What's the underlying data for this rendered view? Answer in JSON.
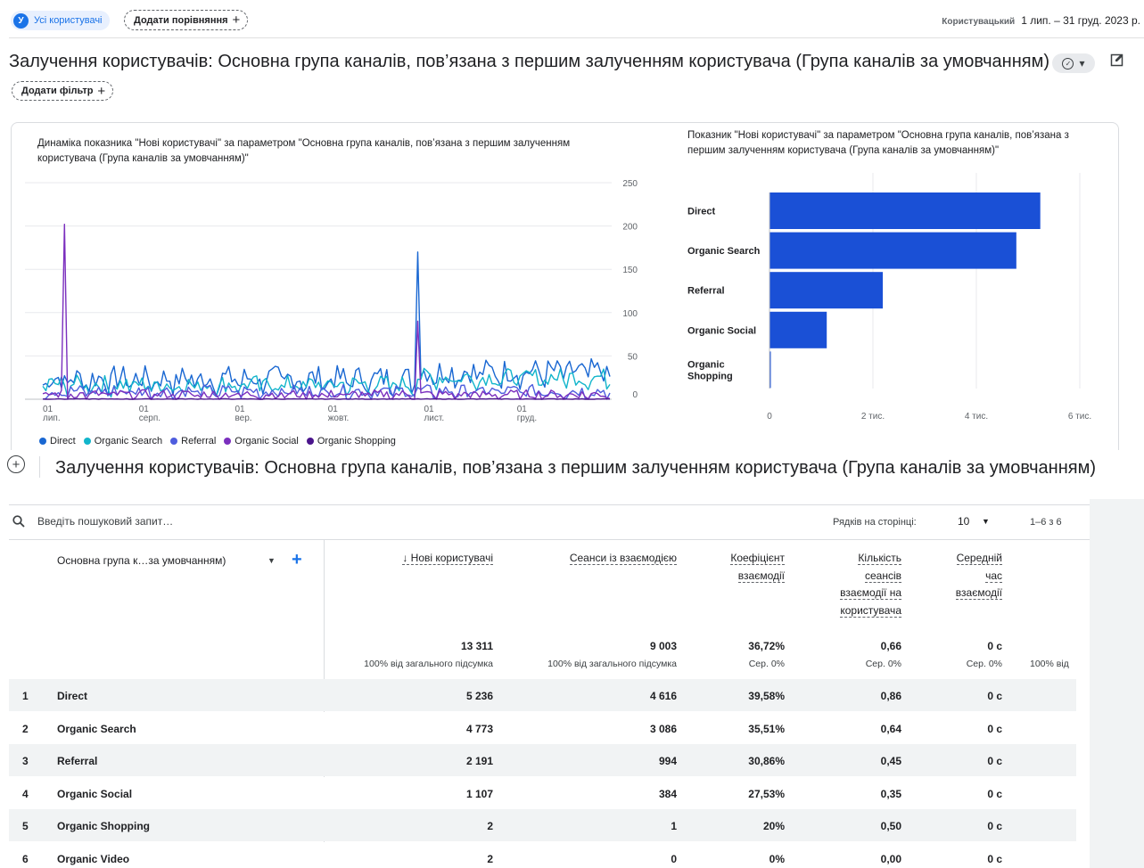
{
  "topbar": {
    "segment_avatar": "У",
    "segment_label": "Усі користувачі",
    "compare_label": "Додати порівняння",
    "date_type": "Користувацький",
    "date_range": "1 лип. – 31 груд. 2023 р."
  },
  "page": {
    "title": "Залучення користувачів: Основна група каналів, пов’язана з першим залученням користувача (Група каналів за умовчанням)",
    "add_filter": "Додати фільтр",
    "plus": "+"
  },
  "line_chart": {
    "title": "Динаміка показника \"Нові користувачі\" за параметром \"Основна група каналів, пов’язана з першим залученням користувача (Група каналів за умовчанням)\""
  },
  "bar_chart": {
    "title": "Показник \"Нові користувачі\" за параметром \"Основна група каналів, пов’язана з першим залученням користувача (Група каналів за умовчанням)\""
  },
  "chart_data": [
    {
      "type": "line",
      "title": "Динаміка показника \"Нові користувачі\" за параметром \"Основна група каналів, пов’язана з першим залученням користувача (Група каналів за умовчанням)\"",
      "x_ticks": [
        [
          "01",
          "лип."
        ],
        [
          "01",
          "серп."
        ],
        [
          "01",
          "вер."
        ],
        [
          "01",
          "жовт."
        ],
        [
          "01",
          "лист."
        ],
        [
          "01",
          "груд."
        ]
      ],
      "x_range": [
        "2023-07-01",
        "2023-12-31"
      ],
      "y_ticks": [
        0,
        50,
        100,
        150,
        200,
        250
      ],
      "ylim": [
        0,
        250
      ],
      "legend_placement": "bottom",
      "series": [
        {
          "name": "Direct",
          "color": "#1967d2"
        },
        {
          "name": "Organic Search",
          "color": "#12b5cb"
        },
        {
          "name": "Referral",
          "color": "#4e5dde"
        },
        {
          "name": "Organic Social",
          "color": "#7b2fbe"
        },
        {
          "name": "Organic Shopping",
          "color": "#4a148c"
        }
      ],
      "peaks": [
        {
          "series": "Organic Social",
          "date": "2023-07-08",
          "value": 202
        },
        {
          "series": "Direct",
          "date": "2023-10-30",
          "value": 170
        },
        {
          "series": "Organic Social",
          "date": "2023-10-30",
          "value": 90
        }
      ]
    },
    {
      "type": "bar",
      "orientation": "horizontal",
      "title": "Показник \"Нові користувачі\" за параметром \"Основна група каналів, пов’язана з першим залученням користувача (Група каналів за умовчанням)\"",
      "categories": [
        "Direct",
        "Organic Search",
        "Referral",
        "Organic Social",
        "Organic Shopping"
      ],
      "category_labels": [
        [
          "Direct"
        ],
        [
          "Organic Search"
        ],
        [
          "Referral"
        ],
        [
          "Organic Social"
        ],
        [
          "Organic",
          "Shopping"
        ]
      ],
      "values": [
        5236,
        4773,
        2191,
        1107,
        2
      ],
      "xlim": [
        0,
        6000
      ],
      "x_ticks": [
        0,
        2000,
        4000,
        6000
      ],
      "x_tick_labels": [
        "0",
        "2 тис.",
        "4 тис.",
        "6 тис."
      ],
      "color": "#1a50d6"
    }
  ],
  "table": {
    "title": "Залучення користувачів: Основна група каналів, пов’язана з першим залученням користувача (Група каналів за умовчанням)",
    "search_placeholder": "Введіть пошуковий запит…",
    "rows_per_page_label": "Рядків на сторінці:",
    "rows_per_page": "10",
    "pager": "1–6 з 6",
    "dimension_header": "Основна група к…за умовчанням)",
    "columns": [
      {
        "lines": [
          "↓ Нові користувачі"
        ],
        "total": "13 311",
        "sub": "100% від загального підсумка"
      },
      {
        "lines": [
          "Сеанси із взаємодією"
        ],
        "total": "9 003",
        "sub": "100% від загального підсумка"
      },
      {
        "lines": [
          "Коефіцієнт",
          "взаємодії"
        ],
        "total": "36,72%",
        "sub": "Сер. 0%"
      },
      {
        "lines": [
          "Кількість",
          "сеансів",
          "взаємодії на",
          "користувача"
        ],
        "total": "0,66",
        "sub": "Сер. 0%"
      },
      {
        "lines": [
          "Середній",
          "час",
          "взаємодії"
        ],
        "total": "0 с",
        "sub": "Сер. 0%"
      },
      {
        "lines": [],
        "total": "",
        "sub": "100% від"
      }
    ],
    "rows": [
      {
        "idx": "1",
        "name": "Direct",
        "vals": [
          "5 236",
          "4 616",
          "39,58%",
          "0,86",
          "0 с"
        ]
      },
      {
        "idx": "2",
        "name": "Organic Search",
        "vals": [
          "4 773",
          "3 086",
          "35,51%",
          "0,64",
          "0 с"
        ]
      },
      {
        "idx": "3",
        "name": "Referral",
        "vals": [
          "2 191",
          "994",
          "30,86%",
          "0,45",
          "0 с"
        ]
      },
      {
        "idx": "4",
        "name": "Organic Social",
        "vals": [
          "1 107",
          "384",
          "27,53%",
          "0,35",
          "0 с"
        ]
      },
      {
        "idx": "5",
        "name": "Organic Shopping",
        "vals": [
          "2",
          "1",
          "20%",
          "0,50",
          "0 с"
        ]
      },
      {
        "idx": "6",
        "name": "Organic Video",
        "vals": [
          "2",
          "0",
          "0%",
          "0,00",
          "0 с"
        ]
      }
    ]
  }
}
